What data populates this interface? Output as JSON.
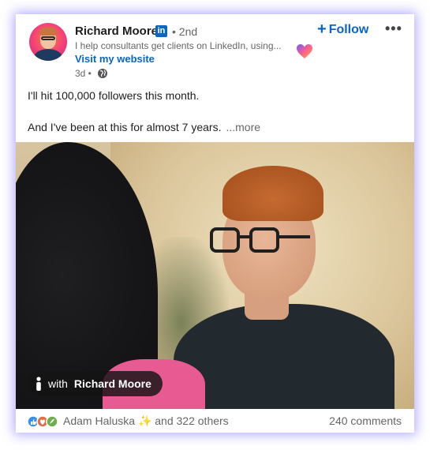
{
  "post": {
    "author": {
      "name": "Richard Moore",
      "badge": "in",
      "degree": "• 2nd",
      "headline": "I help consultants get clients on LinkedIn, using...",
      "visit_link": "Visit my website",
      "time": "3d •"
    },
    "follow_label": "Follow",
    "follow_plus": "+",
    "menu_label": "•••",
    "text_line1": "I'll hit 100,000 followers this month.",
    "text_line2": "And I've been at this for almost 7 years.",
    "see_more": "...more"
  },
  "image": {
    "tag_prefix": "with",
    "tag_name": "Richard Moore"
  },
  "footer": {
    "reactor_name": "Adam Haluska",
    "sparkle": "✨",
    "reaction_suffix": "and 322 others",
    "comments": "240 comments"
  },
  "colors": {
    "brand_blue": "#0a66c2",
    "frame_glow": "#7c6cff"
  },
  "icons": [
    "linkedin-badge-icon",
    "heart-gradient-icon",
    "globe-icon",
    "plus-icon",
    "more-dots-icon",
    "person-tag-icon",
    "like-reaction-icon",
    "love-reaction-icon",
    "insightful-reaction-icon"
  ]
}
